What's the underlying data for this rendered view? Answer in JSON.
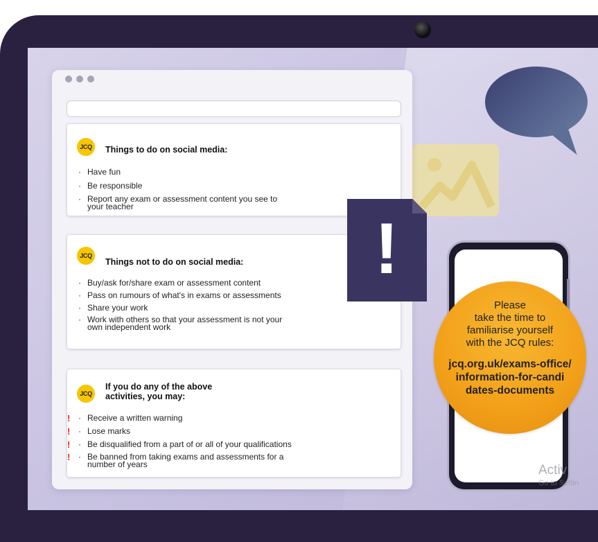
{
  "cards": [
    {
      "logo": "JCQ",
      "title": "Things to do on social media:",
      "items": [
        "Have fun",
        "Be responsible",
        "Report any exam or assessment content you see to\nyour teacher"
      ]
    },
    {
      "logo": "JCQ",
      "title": "Things not to do on social media:",
      "items": [
        "Buy/ask for/share exam or assessment content",
        "Pass on rumours of what's in exams or assessments",
        "Share your work",
        "Work with others so that your assessment is not your\nown independent work"
      ]
    },
    {
      "logo": "JCQ",
      "title": "If you do any of the above\nactivities, you may:",
      "items": [
        "Receive a written warning",
        "Lose marks",
        "Be disqualified from a part of or all of your qualifications",
        "Be banned from taking exams and assessments for a\nnumber of years"
      ]
    }
  ],
  "bullet": "·",
  "warning_mark": "!",
  "doc_mark": "!",
  "phone_circle": {
    "lead": "Please\ntake the time to\nfamiliarise yourself\nwith the JCQ rules:",
    "url": "jcq.org.uk/exams-office/\ninformation-for-candi\ndates-documents"
  },
  "watermark": {
    "line1": "Activ",
    "line2": "Go to Settin"
  },
  "icons": [
    "speech-bubble-icon",
    "image-icon",
    "warning-document-icon",
    "smartphone-icon",
    "webcam-icon"
  ],
  "colors": {
    "laptop_frame": "#2a2140",
    "screen_bg": "#c9c3e2",
    "logo_yellow": "#f7c600",
    "warning_red": "#e0261f",
    "circle_orange": "#f3a21a",
    "doc_navy": "#3a3460"
  }
}
